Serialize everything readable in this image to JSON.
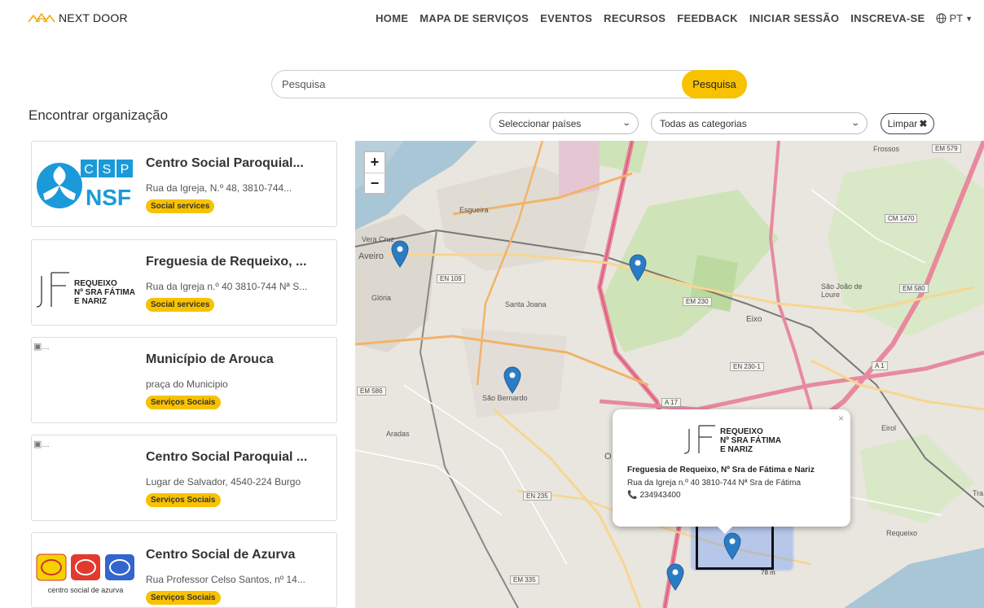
{
  "header": {
    "brand": "NEXT DOOR",
    "nav": [
      "HOME",
      "MAPA DE SERVIÇOS",
      "EVENTOS",
      "RECURSOS",
      "FEEDBACK",
      "INICIAR SESSÃO",
      "INSCREVA-SE"
    ],
    "language": "PT",
    "icons": [
      "house-logo-icon",
      "globe-icon",
      "caret-down-icon"
    ]
  },
  "search": {
    "placeholder": "Pesquisa",
    "button": "Pesquisa"
  },
  "heading": "Encontrar organização",
  "filters": {
    "countries": "Seleccionar países",
    "categories": "Todas as categorias",
    "clear": "Limpar"
  },
  "organizations": [
    {
      "name": "Centro Social Paroquial...",
      "address": "Rua da Igreja, N.º 48, 3810-744...",
      "category": "Social services",
      "logo": "csp-nsf-logo"
    },
    {
      "name": "Freguesia de Requeixo, ...",
      "address": "Rua da Igreja n.º 40 3810-744 Nª S...",
      "category": "Social services",
      "logo": "jf-requeixo-logo",
      "logo_text": [
        "REQUEIXO",
        "Nº SRA FÁTIMA",
        "E NARIZ"
      ]
    },
    {
      "name": "Município de Arouca",
      "address": "praça do Municipio",
      "category": "Serviços Sociais",
      "logo": "broken-image",
      "logo_alt": "..."
    },
    {
      "name": "Centro Social Paroquial ...",
      "address": "Lugar de Salvador, 4540-224 Burgo",
      "category": "Serviços Sociais",
      "logo": "broken-image",
      "logo_alt": "..."
    },
    {
      "name": "Centro Social de Azurva",
      "address": "Rua Professor Celso Santos, nº 14...",
      "category": "Serviços Sociais",
      "logo": "azurva-logo",
      "logo_caption": "centro social de azurva"
    }
  ],
  "map": {
    "zoom_in": "+",
    "zoom_out": "−",
    "places": [
      "Esgueira",
      "Vera Cruz",
      "Aveiro",
      "Glória",
      "Santa Joana",
      "São Bernardo",
      "Eixo",
      "Aradas",
      "Eirol",
      "Frossos",
      "São João de Loure",
      "Requeixo",
      "O",
      "Tra"
    ],
    "roads": [
      "EM 579",
      "CM 1470",
      "EN 109",
      "EM 230",
      "EM 580",
      "EN 230-1",
      "A 17",
      "A 1",
      "EM 586",
      "EN 235",
      "EM 335"
    ],
    "scale": "78 m",
    "popup": {
      "close": "×",
      "logo_text": [
        "REQUEIXO",
        "Nº SRA FÁTIMA",
        "E NARIZ"
      ],
      "name": "Freguesia de Requeixo, Nº Sra de Fátima e Nariz",
      "address": "Rua da Igreja n.º 40 3810-744 Nª Sra de Fátima",
      "phone": "234943400"
    },
    "pin_color": "#2b7cc4"
  },
  "colors": {
    "accent": "#f8c200",
    "map_pin": "#2b7cc4"
  }
}
